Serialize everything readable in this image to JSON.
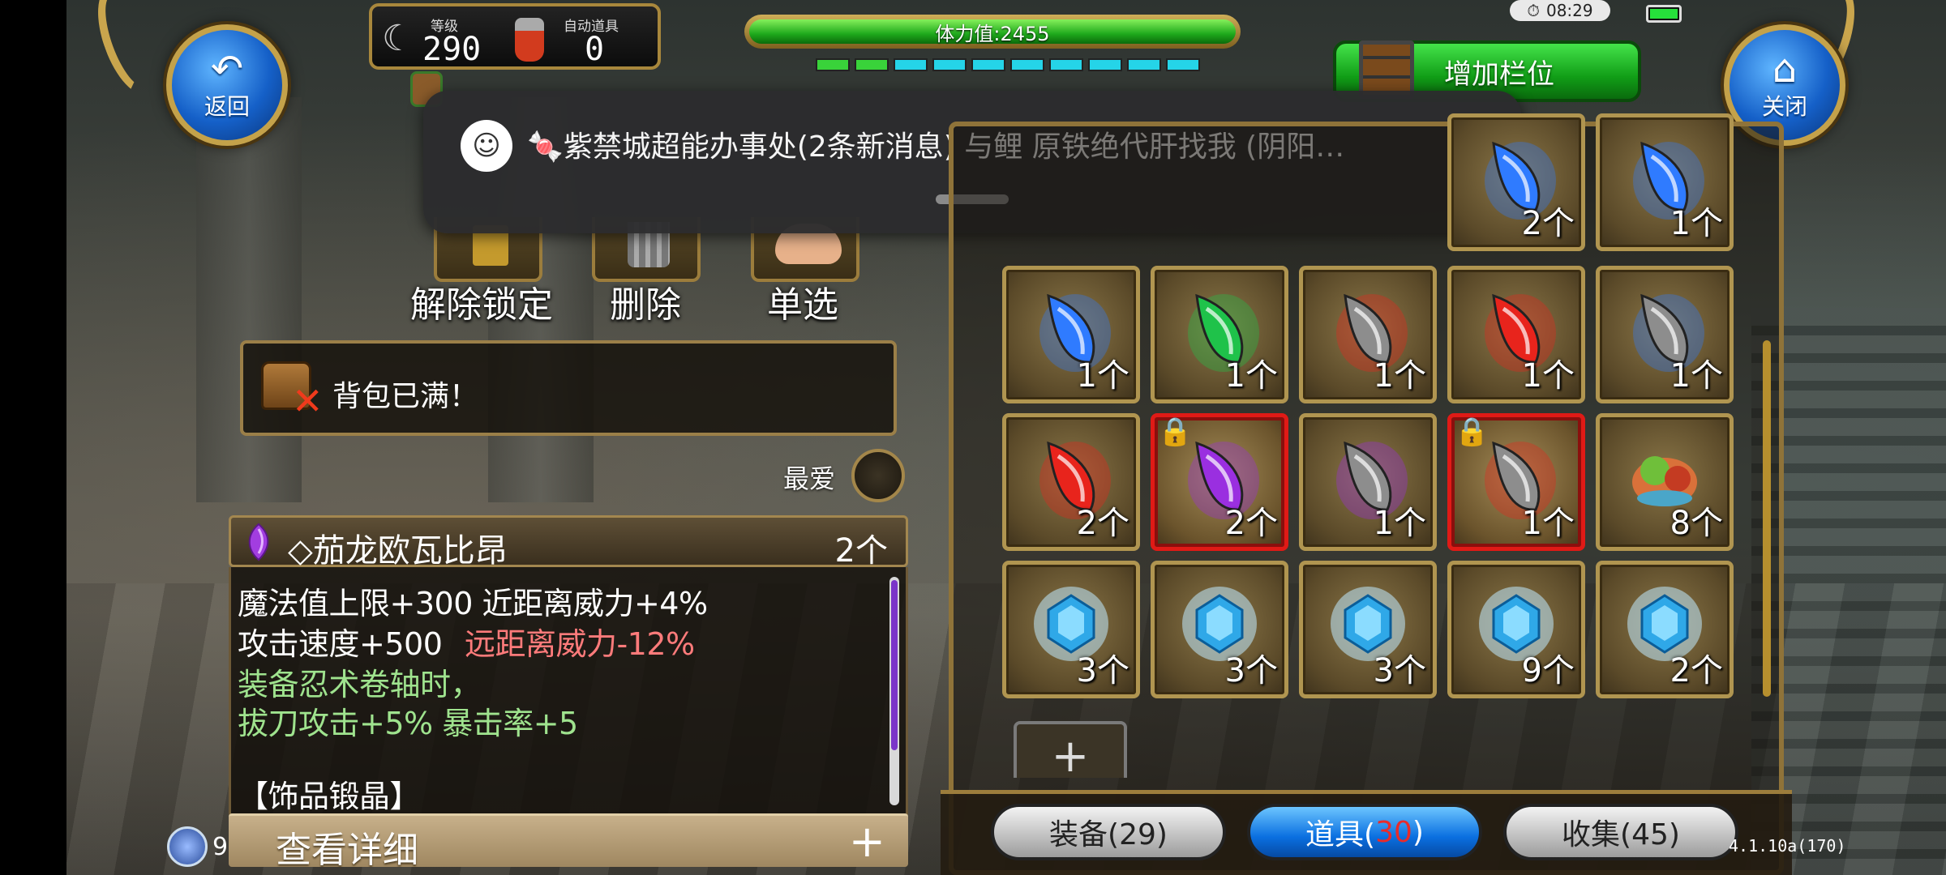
{
  "nav": {
    "back_label": "返回",
    "close_label": "关闭"
  },
  "status": {
    "level_label": "等级",
    "level_value": "290",
    "auto_item_label": "自动道具",
    "auto_item_value": "0",
    "stamina_text": "体力值:2455",
    "stamina_segments": [
      "#39d33a",
      "#39d33a",
      "#25d4e8",
      "#25d4e8",
      "#25d4e8",
      "#25d4e8",
      "#25d4e8",
      "#25d4e8",
      "#25d4e8",
      "#25d4e8"
    ],
    "clock": "08:29",
    "add_slot_label": "增加栏位"
  },
  "notification": {
    "text": "🍬紫禁城超能办事处(2条新消息) 与鲤 原铁绝代肝找我 (阴阳…"
  },
  "actions": {
    "unlock_label": "解除锁定",
    "delete_label": "删除",
    "single_label": "单选"
  },
  "bag_full_text": "背包已满！",
  "favorite_label": "最爱",
  "selected_item": {
    "name": "◇茄龙欧瓦比昂",
    "qty": "2个",
    "desc": {
      "line1": "魔法值上限+300 近距离威力+4%",
      "line2a": "攻击速度+500",
      "line2b": "远距离威力-12%",
      "line3": "装备忍术卷轴时，",
      "line4": "拔刀攻击+5% 暴击率+5",
      "line5": "【饰品锻晶】"
    },
    "details_label": "查看详细",
    "details_plus": "+"
  },
  "orb_value": "9",
  "inventory": {
    "rows": [
      [
        {
          "gem": "blue",
          "qty": "2个",
          "locked": false
        },
        {
          "gem": "blue",
          "qty": "1个",
          "locked": false
        }
      ],
      [
        {
          "gem": "blue",
          "qty": "1个",
          "locked": false
        },
        {
          "gem": "green",
          "qty": "1个",
          "locked": false
        },
        {
          "gem": "grey-red",
          "qty": "1个",
          "locked": false
        },
        {
          "gem": "red",
          "qty": "1个",
          "locked": false
        },
        {
          "gem": "grey-blue",
          "qty": "1个",
          "locked": false
        }
      ],
      [
        {
          "gem": "red",
          "qty": "2个",
          "locked": false
        },
        {
          "gem": "purple",
          "qty": "2个",
          "locked": true
        },
        {
          "gem": "grey-purple",
          "qty": "1个",
          "locked": false
        },
        {
          "gem": "grey-red",
          "qty": "1个",
          "locked": true
        },
        {
          "gem": "food",
          "qty": "8个",
          "locked": false
        }
      ],
      [
        {
          "gem": "crystal",
          "qty": "3个",
          "locked": false
        },
        {
          "gem": "crystal",
          "qty": "3个",
          "locked": false
        },
        {
          "gem": "crystal",
          "qty": "3个",
          "locked": false
        },
        {
          "gem": "crystal",
          "qty": "9个",
          "locked": false
        },
        {
          "gem": "crystal",
          "qty": "2个",
          "locked": false
        }
      ]
    ],
    "add_slot_symbol": "+"
  },
  "tabs": {
    "equip": "装备(29)",
    "items_prefix": "道具(",
    "items_count": "30",
    "items_suffix": ")",
    "collect": "收集(45)"
  },
  "version": "4.1.10a(170)",
  "colors": {
    "blue": "#2f7bff",
    "green": "#1fc24a",
    "red": "#e8241c",
    "purple": "#9a2fe0",
    "grey-red": "#8a8a8a",
    "grey-blue": "#8a8a8a",
    "grey-purple": "#8a8a8a"
  }
}
